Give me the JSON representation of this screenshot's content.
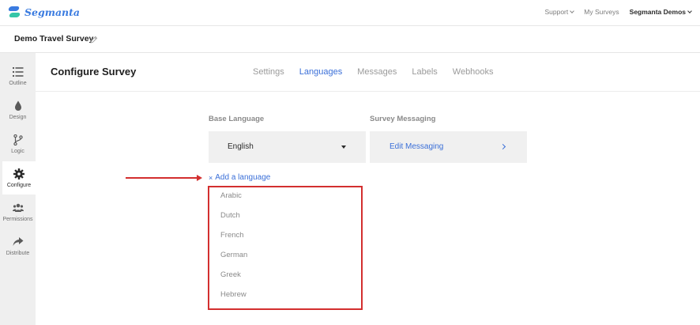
{
  "topbar": {
    "logo_text": "Segmanta",
    "nav": {
      "support": "Support",
      "my_surveys": "My Surveys",
      "account": "Segmanta Demos"
    }
  },
  "survey": {
    "title": "Demo Travel Survey"
  },
  "sidebar": {
    "items": [
      {
        "label": "Outline",
        "icon": "list-icon"
      },
      {
        "label": "Design",
        "icon": "drop-icon"
      },
      {
        "label": "Logic",
        "icon": "branch-icon"
      },
      {
        "label": "Configure",
        "icon": "gear-icon"
      },
      {
        "label": "Permissions",
        "icon": "users-icon"
      },
      {
        "label": "Distribute",
        "icon": "share-icon"
      }
    ],
    "active": "Configure"
  },
  "main": {
    "title": "Configure Survey",
    "tabs": [
      {
        "label": "Settings"
      },
      {
        "label": "Languages"
      },
      {
        "label": "Messages"
      },
      {
        "label": "Labels"
      },
      {
        "label": "Webhooks"
      }
    ],
    "active_tab": "Languages",
    "base_language": {
      "label": "Base Language",
      "value": "English"
    },
    "survey_messaging": {
      "label": "Survey Messaging",
      "link": "Edit Messaging"
    },
    "add_language": {
      "icon": "×",
      "label": "Add a language"
    },
    "language_options": [
      "Arabic",
      "Dutch",
      "French",
      "German",
      "Greek",
      "Hebrew"
    ]
  },
  "colors": {
    "accent": "#3a6fd8",
    "annotation": "#d32f2f",
    "sidebar_bg": "#efefef"
  }
}
